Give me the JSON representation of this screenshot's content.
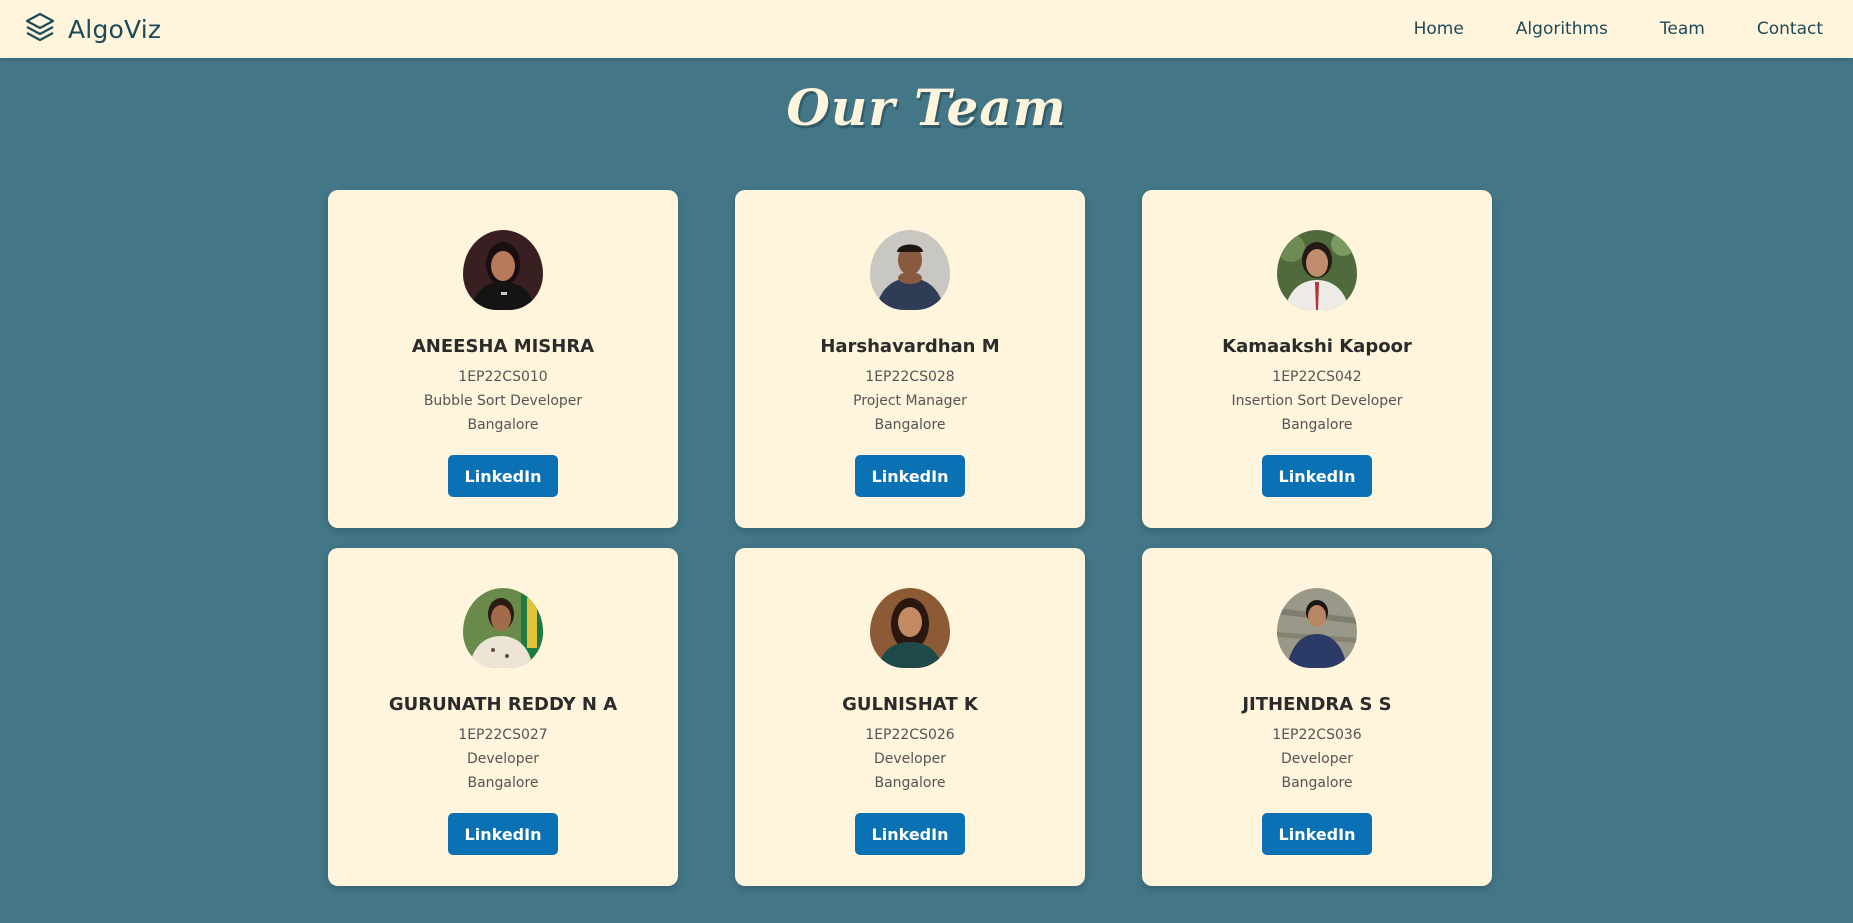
{
  "brand": {
    "name": "AlgoViz",
    "icon": "layers-icon"
  },
  "nav": {
    "links": [
      "Home",
      "Algorithms",
      "Team",
      "Contact"
    ]
  },
  "page": {
    "title": "Our Team"
  },
  "colors": {
    "background": "#437787",
    "card": "#fff4dc",
    "button": "#0a71b5",
    "navbar": "#fff4dc"
  },
  "team": [
    {
      "name": "ANEESHA MISHRA",
      "usn": "1EP22CS010",
      "role": "Bubble Sort Developer",
      "location": "Bangalore",
      "button": "LinkedIn",
      "photo": "profile-photo"
    },
    {
      "name": "Harshavardhan M",
      "usn": "1EP22CS028",
      "role": "Project Manager",
      "location": "Bangalore",
      "button": "LinkedIn",
      "photo": "profile-photo"
    },
    {
      "name": "Kamaakshi Kapoor",
      "usn": "1EP22CS042",
      "role": "Insertion Sort Developer",
      "location": "Bangalore",
      "button": "LinkedIn",
      "photo": "profile-photo"
    },
    {
      "name": "GURUNATH REDDY N A",
      "usn": "1EP22CS027",
      "role": "Developer",
      "location": "Bangalore",
      "button": "LinkedIn",
      "photo": "profile-photo"
    },
    {
      "name": "GULNISHAT K",
      "usn": "1EP22CS026",
      "role": "Developer",
      "location": "Bangalore",
      "button": "LinkedIn",
      "photo": "profile-photo"
    },
    {
      "name": "JITHENDRA S S",
      "usn": "1EP22CS036",
      "role": "Developer",
      "location": "Bangalore",
      "button": "LinkedIn",
      "photo": "profile-photo"
    }
  ]
}
